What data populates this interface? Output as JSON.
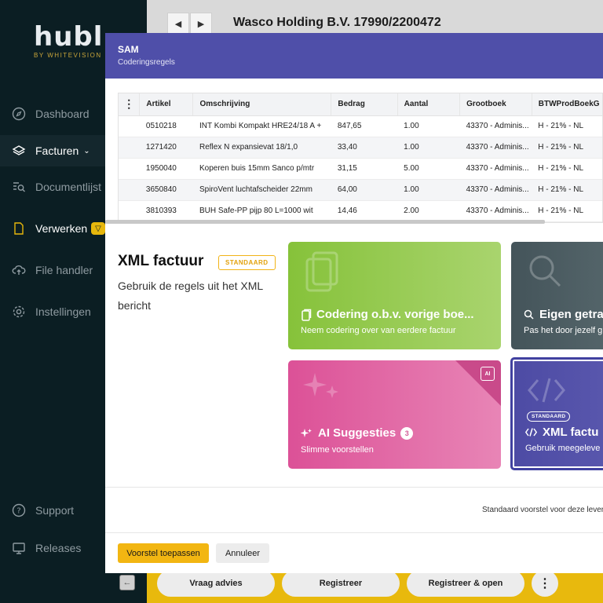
{
  "sidebar": {
    "logo": "hubl",
    "logo_sub": "BY WHITEVISION",
    "items": [
      {
        "label": "Dashboard",
        "icon": "compass-icon"
      },
      {
        "label": "Facturen",
        "icon": "layers-icon",
        "chevron": "⌄"
      },
      {
        "label": "Documentlijst",
        "icon": "search-list-icon"
      },
      {
        "label": "Verwerken",
        "icon": "document-icon",
        "badge": "▽"
      },
      {
        "label": "File handler",
        "icon": "cloud-upload-icon"
      },
      {
        "label": "Instellingen",
        "icon": "gear-icon"
      }
    ],
    "bottom_items": [
      {
        "label": "Support",
        "icon": "help-icon"
      },
      {
        "label": "Releases",
        "icon": "monitor-icon"
      }
    ]
  },
  "header": {
    "prev": "◀",
    "next": "▶",
    "title": "Wasco Holding B.V. 17990/2200472"
  },
  "modal": {
    "title": "SAM",
    "subtitle": "Coderingsregels",
    "table": {
      "menu": "⋮",
      "columns": [
        "Artikel",
        "Omschrijving",
        "Bedrag",
        "Aantal",
        "Grootboek",
        "BTWProdBoekG"
      ],
      "rows": [
        [
          "0510218",
          "INT Kombi Kompakt HRE24/18 A +",
          "847,65",
          "1.00",
          "43370 - Adminis...",
          "H - 21% - NL"
        ],
        [
          "1271420",
          "Reflex N expansievat 18/1,0",
          "33,40",
          "1.00",
          "43370 - Adminis...",
          "H - 21% - NL"
        ],
        [
          "1950040",
          "Koperen buis 15mm Sanco p/mtr",
          "31,15",
          "5.00",
          "43370 - Adminis...",
          "H - 21% - NL"
        ],
        [
          "3650840",
          "SpiroVent luchtafscheider 22mm",
          "64,00",
          "1.00",
          "43370 - Adminis...",
          "H - 21% - NL"
        ],
        [
          "3810393",
          "BUH Safe-PP pijp 80 L=1000 wit",
          "14,46",
          "2.00",
          "43370 - Adminis...",
          "H - 21% - NL"
        ]
      ]
    },
    "selected": {
      "title": "XML factuur",
      "badge": "STANDAARD",
      "description": "Gebruik de regels uit het XML bericht"
    },
    "cards": [
      {
        "title": "Codering o.b.v. vorige boe...",
        "desc": "Neem codering over van eerdere factuur",
        "icon": "copy-icon"
      },
      {
        "title": "Eigen getra",
        "desc": "Pas het door jezelf g",
        "icon": "search-icon"
      },
      {
        "title": "AI Suggesties",
        "count": "3",
        "desc": "Slimme voorstellen",
        "icon": "sparkle-icon",
        "corner": "AI"
      },
      {
        "title": "XML factu",
        "desc": "Gebruik meegeleve",
        "icon": "code-icon",
        "badge": "STANDAARD"
      }
    ],
    "footer_note": "Standaard voorstel voor deze leveran",
    "apply_label": "Voorstel toepassen",
    "cancel_label": "Annuleer"
  },
  "bottombar": {
    "back": "←",
    "buttons": [
      "Vraag advies",
      "Registreer",
      "Registreer & open"
    ],
    "more": "⋮"
  },
  "colors": {
    "sidebar": "#0b1e23",
    "modal_header": "#4f4fa9",
    "accent_yellow": "#f2b612",
    "card_green": "#8cc63f",
    "card_slate": "#4a5a5f",
    "card_pink": "#e0579b",
    "card_indigo": "#5452a8"
  }
}
